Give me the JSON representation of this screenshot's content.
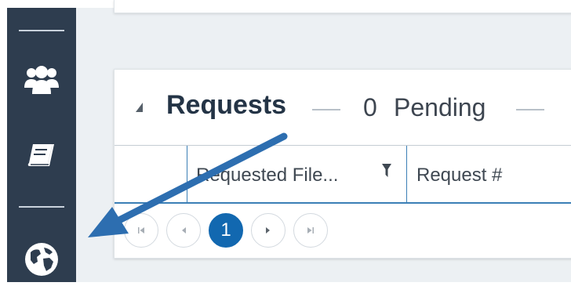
{
  "sidebar": {
    "icons": [
      "users-icon",
      "book-icon",
      "globe-icon"
    ]
  },
  "requests_panel": {
    "title": "Requests",
    "pending_count": "0",
    "pending_label": "Pending"
  },
  "table": {
    "columns": [
      {
        "label": "Requested File..."
      },
      {
        "label": "Request #"
      }
    ]
  },
  "pagination": {
    "current_page": "1"
  },
  "colors": {
    "sidebar_bg": "#2e3d4f",
    "accent": "#1268b0",
    "annotation_arrow": "#2d6eb0"
  }
}
